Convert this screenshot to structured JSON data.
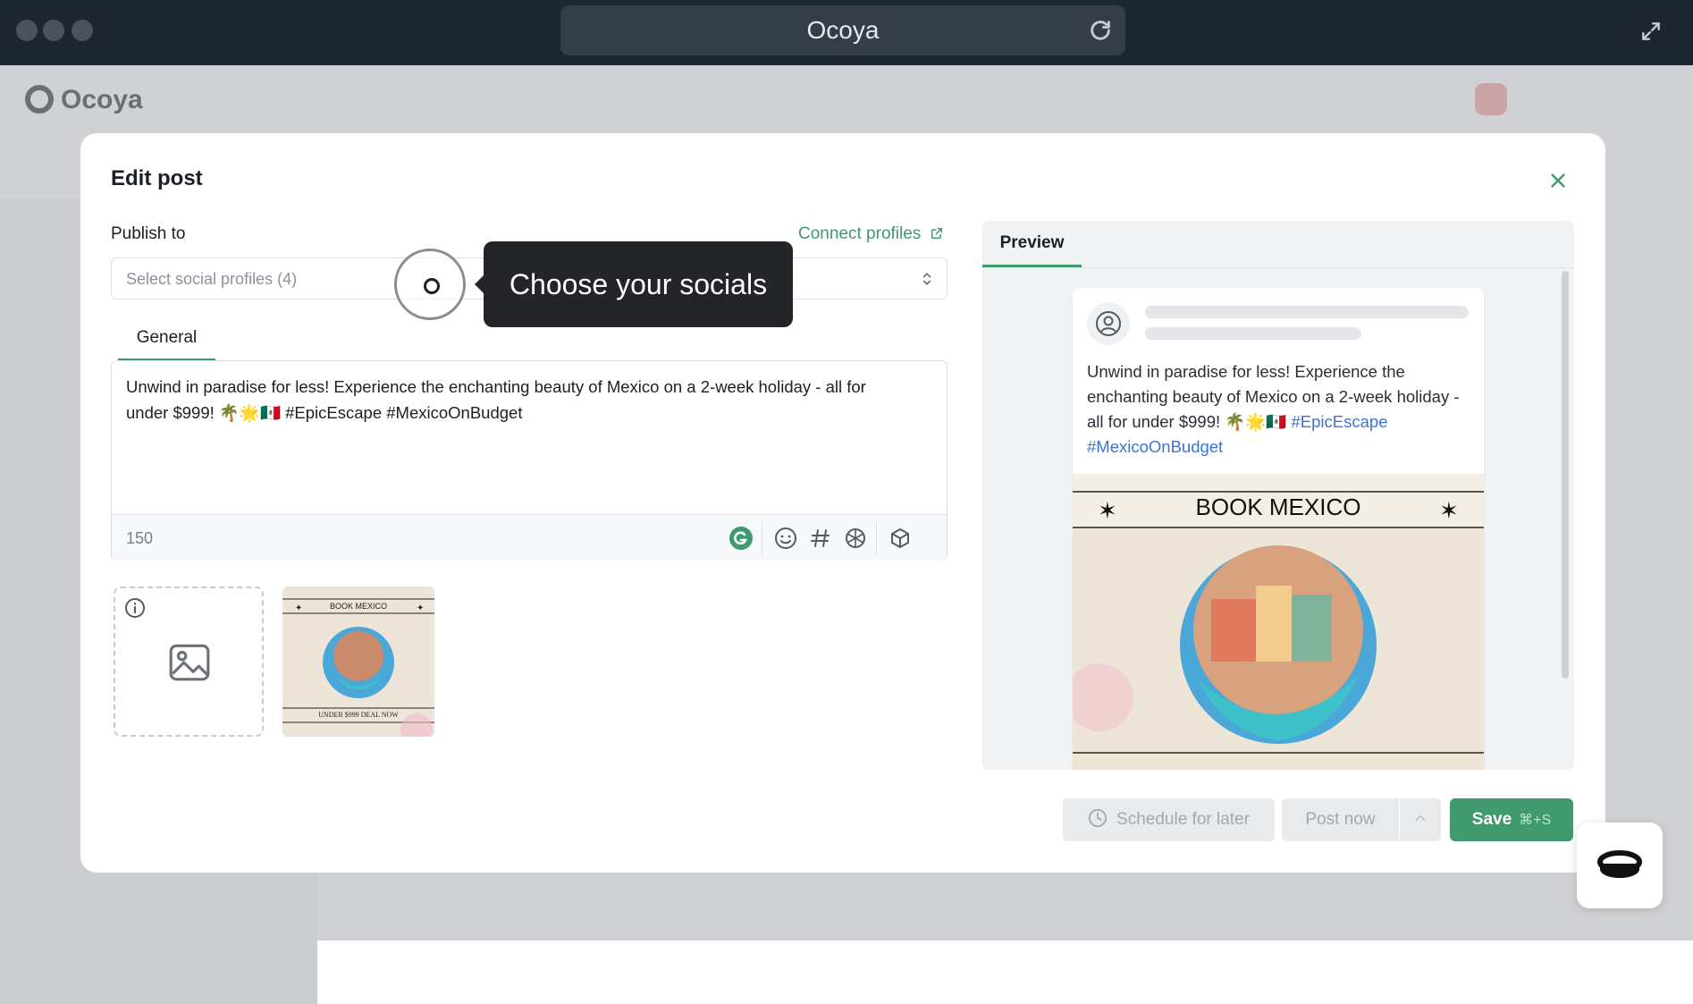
{
  "window": {
    "url_title": "Ocoya"
  },
  "app": {
    "brand": "Ocoya"
  },
  "modal": {
    "title": "Edit post",
    "publish_label": "Publish to",
    "connect_label": "Connect profiles",
    "select_placeholder": "Select social profiles (4)",
    "tab_general": "General",
    "post_text": "Unwind in paradise for less! Experience the enchanting beauty of Mexico on a 2-week holiday - all for under $999! 🌴🌟🇲🇽 #EpicEscape #MexicoOnBudget",
    "char_count": "150",
    "preview_tab": "Preview",
    "preview_text": "Unwind in paradise for less! Experience the enchanting beauty of Mexico on a 2-week holiday - all for under $999! 🌴🌟🇲🇽",
    "preview_hashtag1": "#EpicEscape",
    "preview_hashtag2": "#MexicoOnBudget",
    "image_title": "BOOK MEXICO",
    "thumb_title": "BOOK MEXICO",
    "thumb_footer": "UNDER $999 DEAL NOW",
    "buttons": {
      "schedule": "Schedule for later",
      "post_now": "Post now",
      "save": "Save",
      "save_shortcut": "⌘+S"
    }
  },
  "tooltip": {
    "text": "Choose your socials"
  },
  "colors": {
    "accent": "#3f9a6e",
    "hashtag": "#3b74d6",
    "chrome": "#1e2533"
  }
}
